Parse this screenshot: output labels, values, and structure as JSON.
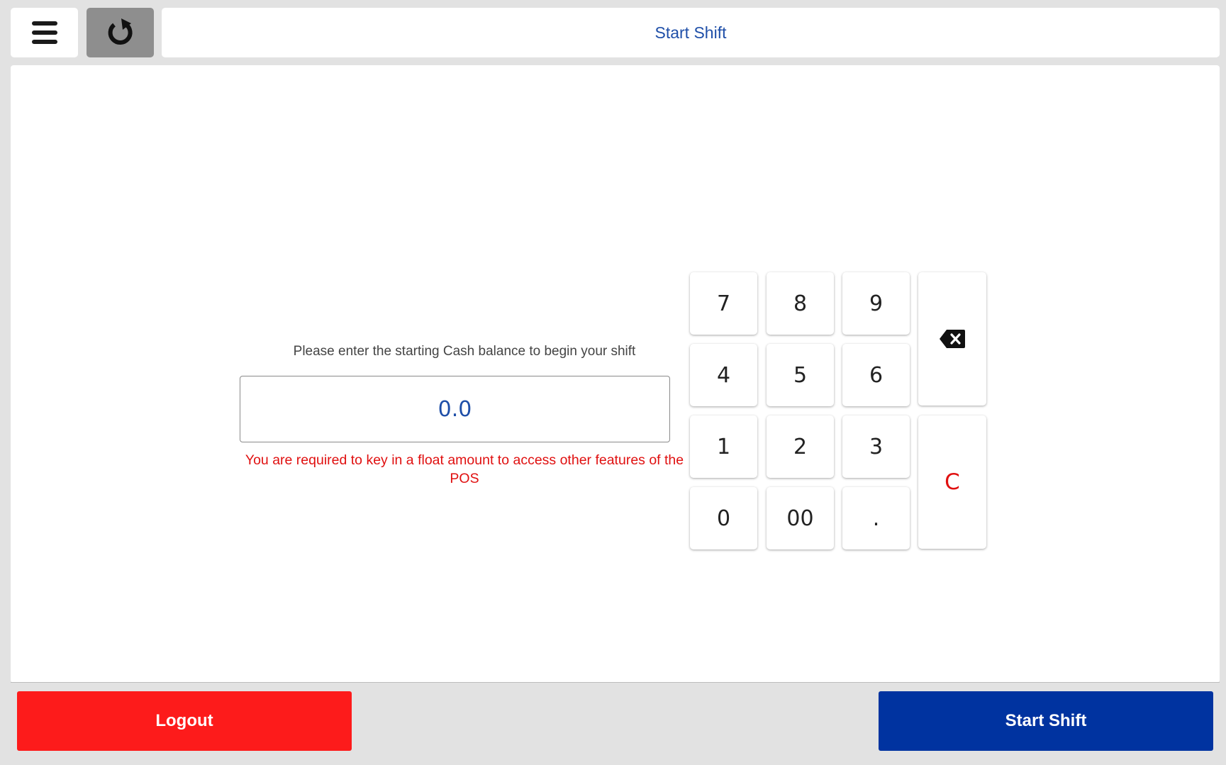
{
  "header": {
    "title": "Start Shift",
    "menu_icon": "hamburger-menu-icon",
    "refresh_icon": "refresh-icon"
  },
  "float_entry": {
    "prompt": "Please enter the starting Cash balance to begin your shift",
    "amount": "0.0",
    "error": "You are required to key in a float amount to access other features of the POS"
  },
  "keypad": {
    "keys": [
      "7",
      "8",
      "9",
      "4",
      "5",
      "6",
      "1",
      "2",
      "3",
      "0",
      "00",
      "."
    ],
    "backspace_icon": "backspace-icon",
    "clear_label": "C"
  },
  "footer": {
    "logout_label": "Logout",
    "start_shift_label": "Start Shift"
  },
  "colors": {
    "accent_blue": "#0033a0",
    "title_blue": "#1f4fa8",
    "danger_red": "#fd1b1b",
    "error_red": "#e01010"
  }
}
